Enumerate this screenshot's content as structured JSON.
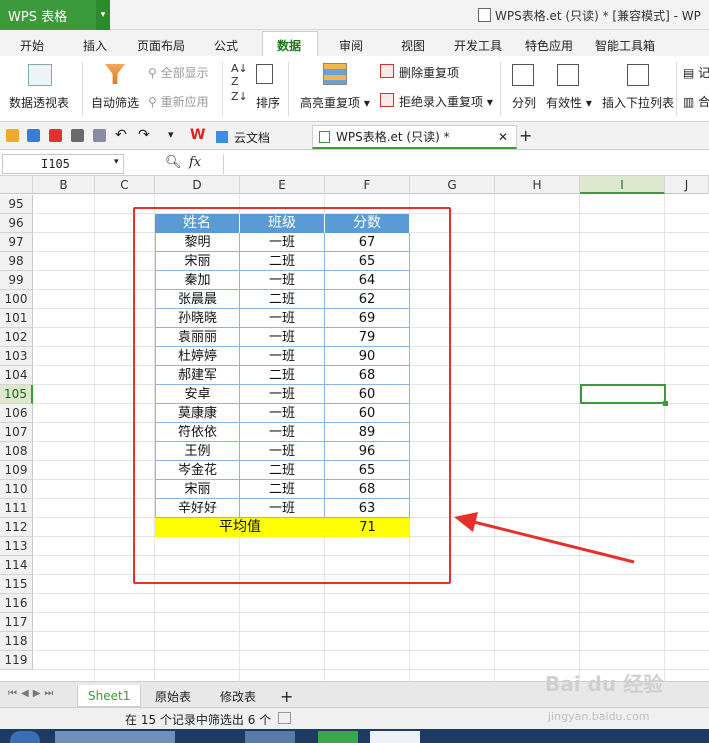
{
  "app": {
    "name": "WPS 表格",
    "title": "WPS表格.et (只读) * [兼容模式] - WP"
  },
  "menu": [
    "开始",
    "插入",
    "页面布局",
    "公式",
    "数据",
    "审阅",
    "视图",
    "开发工具",
    "特色应用",
    "智能工具箱"
  ],
  "ribbon": {
    "pivot": "数据透视表",
    "autofilter": "自动筛选",
    "show_all": "全部显示",
    "reapply": "重新应用",
    "sort": "排序",
    "highlight_dup": "高亮重复项",
    "delete_dup": "删除重复项",
    "reject_dup": "拒绝录入重复项",
    "split": "分列",
    "validity": "有效性",
    "insert_dropdown": "插入下拉列表",
    "extra1": "记",
    "extra2": "合"
  },
  "tabs": [
    {
      "label": "云文档"
    },
    {
      "label": "WPS表格.et (只读) *"
    }
  ],
  "namebox": "I105",
  "fx": "fx",
  "columns": [
    "B",
    "C",
    "D",
    "E",
    "F",
    "G",
    "H",
    "I",
    "J"
  ],
  "rows": [
    "95",
    "96",
    "97",
    "98",
    "99",
    "100",
    "101",
    "102",
    "103",
    "104",
    "105",
    "106",
    "107",
    "108",
    "109",
    "110",
    "111",
    "112",
    "113",
    "114",
    "115",
    "116",
    "117",
    "118",
    "119"
  ],
  "table": {
    "headers": [
      "姓名",
      "班级",
      "分数"
    ],
    "records": [
      [
        "黎明",
        "一班",
        "67"
      ],
      [
        "宋丽",
        "二班",
        "65"
      ],
      [
        "秦加",
        "一班",
        "64"
      ],
      [
        "张晨晨",
        "二班",
        "62"
      ],
      [
        "孙晓晓",
        "一班",
        "69"
      ],
      [
        "袁丽丽",
        "一班",
        "79"
      ],
      [
        "杜婷婷",
        "一班",
        "90"
      ],
      [
        "郝建军",
        "二班",
        "68"
      ],
      [
        "安卓",
        "一班",
        "60"
      ],
      [
        "莫康康",
        "一班",
        "60"
      ],
      [
        "符依依",
        "一班",
        "89"
      ],
      [
        "王例",
        "一班",
        "96"
      ],
      [
        "岑金花",
        "二班",
        "65"
      ],
      [
        "宋丽",
        "二班",
        "68"
      ],
      [
        "辛好好",
        "一班",
        "63"
      ]
    ],
    "avg_label": "平均值",
    "avg_value": "71"
  },
  "sheets": [
    "Sheet1",
    "原始表",
    "修改表"
  ],
  "status": "在 15 个记录中筛选出 6 个",
  "watermark": {
    "brand": "Bai du 经验",
    "url": "jingyan.baidu.com"
  },
  "colors": {
    "accent": "#3b9a3b",
    "header_fill": "#5b9bd5",
    "avg_fill": "#ffff00",
    "annotation": "#e8302a"
  }
}
